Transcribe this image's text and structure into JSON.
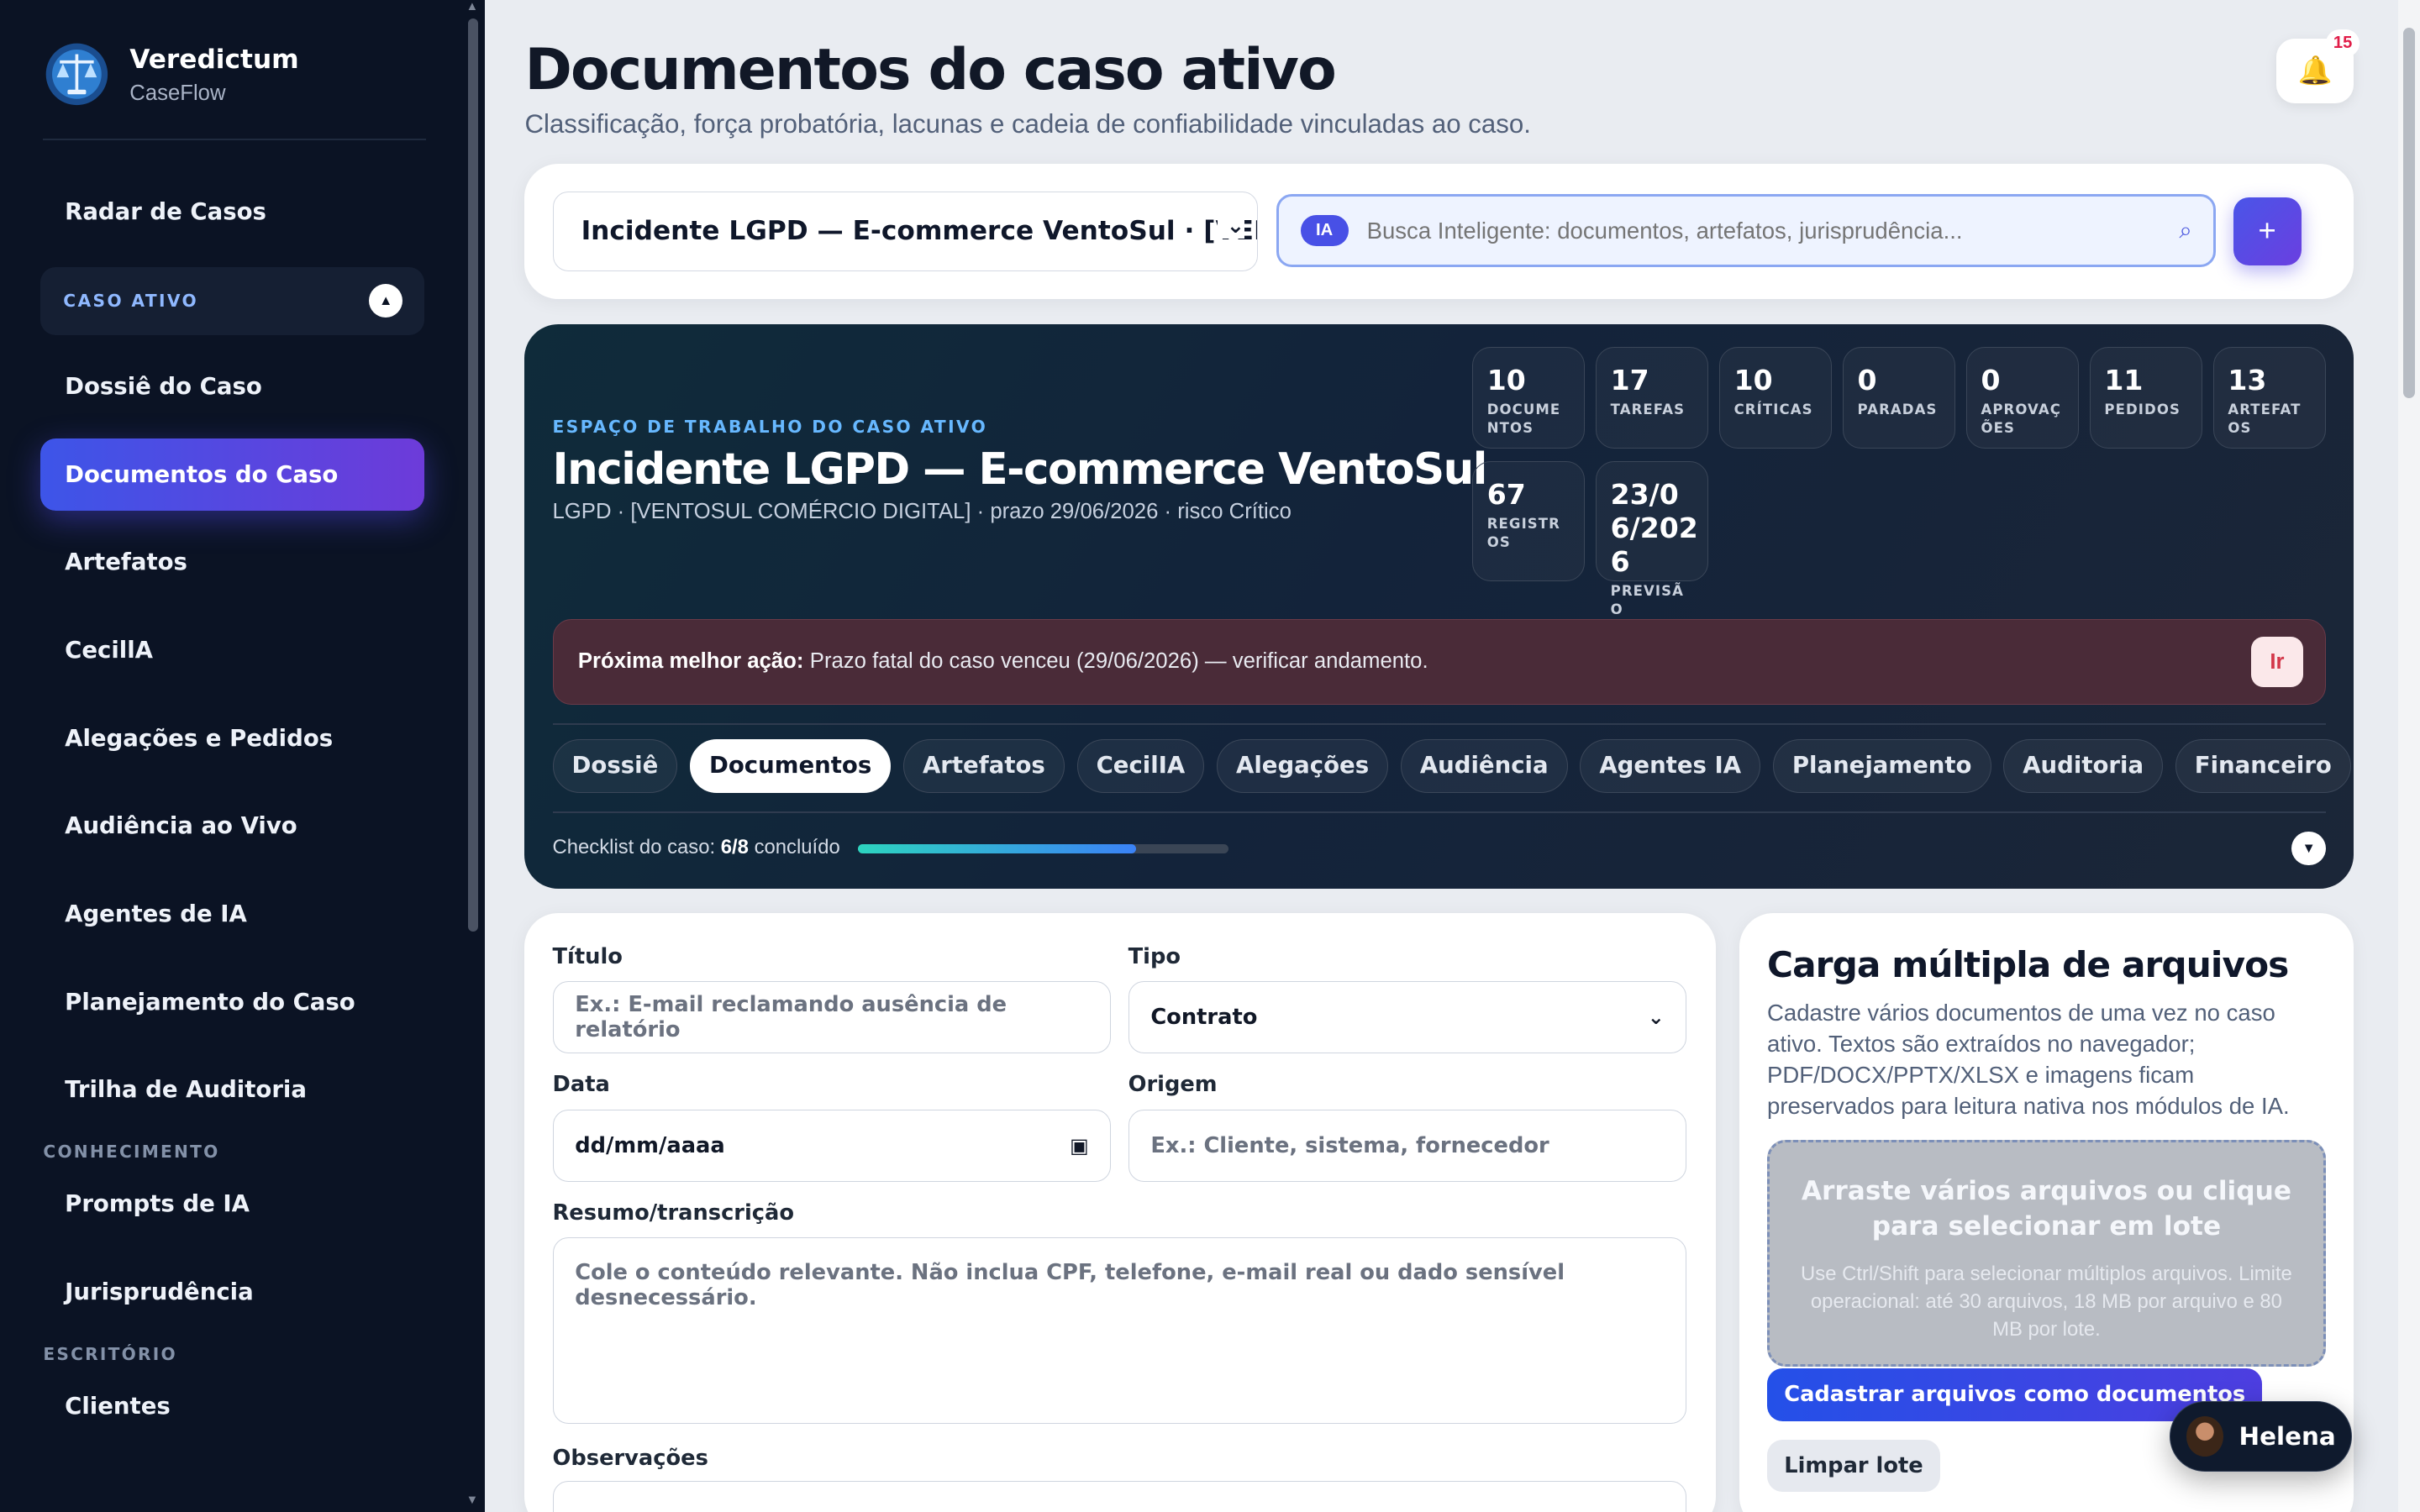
{
  "brand": {
    "name": "Veredictum",
    "sub": "CaseFlow"
  },
  "sidebar": {
    "top_item": "Radar de Casos",
    "active_section": "CASO ATIVO",
    "case_items": [
      "Dossiê do Caso",
      "Documentos do Caso",
      "Artefatos",
      "CecillA",
      "Alegações e Pedidos",
      "Audiência ao Vivo",
      "Agentes de IA",
      "Planejamento do Caso",
      "Trilha de Auditoria"
    ],
    "active_item": "Documentos do Caso",
    "knowledge_label": "CONHECIMENTO",
    "knowledge_items": [
      "Prompts de IA",
      "Jurisprudência"
    ],
    "office_label": "ESCRITÓRIO",
    "office_items": [
      "Clientes"
    ]
  },
  "header": {
    "title": "Documentos do caso ativo",
    "subtitle": "Classificação, força probatória, lacunas e cadeia de confiabilidade vinculadas ao caso.",
    "notifications": "15"
  },
  "search": {
    "case_selected": "Incidente LGPD — E-commerce VentoSul · [VENTOSUL COMÉRCIO DIGITAL]",
    "ai_badge": "IA",
    "placeholder": "Busca Inteligente: documentos, artefatos, jurisprudência..."
  },
  "workspace": {
    "kicker": "ESPAÇO DE TRABALHO DO CASO ATIVO",
    "title": "Incidente LGPD — E-commerce VentoSul",
    "meta": "LGPD · [VENTOSUL COMÉRCIO DIGITAL] · prazo 29/06/2026 · risco Crítico",
    "stats": [
      {
        "value": "10",
        "label": "DOCUMENTOS"
      },
      {
        "value": "17",
        "label": "TAREFAS"
      },
      {
        "value": "10",
        "label": "CRÍTICAS"
      },
      {
        "value": "0",
        "label": "PARADAS"
      },
      {
        "value": "0",
        "label": "APROVAÇÕES"
      },
      {
        "value": "11",
        "label": "PEDIDOS"
      },
      {
        "value": "13",
        "label": "ARTEFATOS"
      },
      {
        "value": "67",
        "label": "REGISTROS"
      },
      {
        "value": "23/06/2026",
        "label": "PREVISÃO"
      }
    ],
    "next_action_label": "Próxima melhor ação:",
    "next_action_text": "Prazo fatal do caso venceu (29/06/2026) — verificar andamento.",
    "next_action_button": "Ir",
    "tabs": [
      "Dossiê",
      "Documentos",
      "Artefatos",
      "CecilIA",
      "Alegações",
      "Audiência",
      "Agentes IA",
      "Planejamento",
      "Auditoria",
      "Financeiro"
    ],
    "active_tab": "Documentos",
    "checklist_label": "Checklist do caso:",
    "checklist_value": "6/8",
    "checklist_suffix": "concluído",
    "checklist_progress": 0.75
  },
  "form": {
    "title_label": "Título",
    "title_placeholder": "Ex.: E-mail reclamando ausência de relatório",
    "type_label": "Tipo",
    "type_value": "Contrato",
    "date_label": "Data",
    "date_placeholder": "dd/mm/aaaa",
    "origin_label": "Origem",
    "origin_placeholder": "Ex.: Cliente, sistema, fornecedor",
    "summary_label": "Resumo/transcrição",
    "summary_placeholder": "Cole o conteúdo relevante. Não inclua CPF, telefone, e-mail real ou dado sensível desnecessário.",
    "notes_label": "Observações"
  },
  "upload": {
    "title": "Carga múltipla de arquivos",
    "description": "Cadastre vários documentos de uma vez no caso ativo. Textos são extraídos no navegador; PDF/DOCX/PPTX/XLSX e imagens ficam preservados para leitura nativa nos módulos de IA.",
    "drop_main": "Arraste vários arquivos ou clique para selecionar em lote",
    "drop_sub": "Use Ctrl/Shift para selecionar múltiplos arquivos. Limite operacional: até 30 arquivos, 18 MB por arquivo e 80 MB por lote.",
    "submit": "Cadastrar arquivos como documentos",
    "clear": "Limpar lote"
  },
  "assistant": {
    "name": "Helena"
  }
}
